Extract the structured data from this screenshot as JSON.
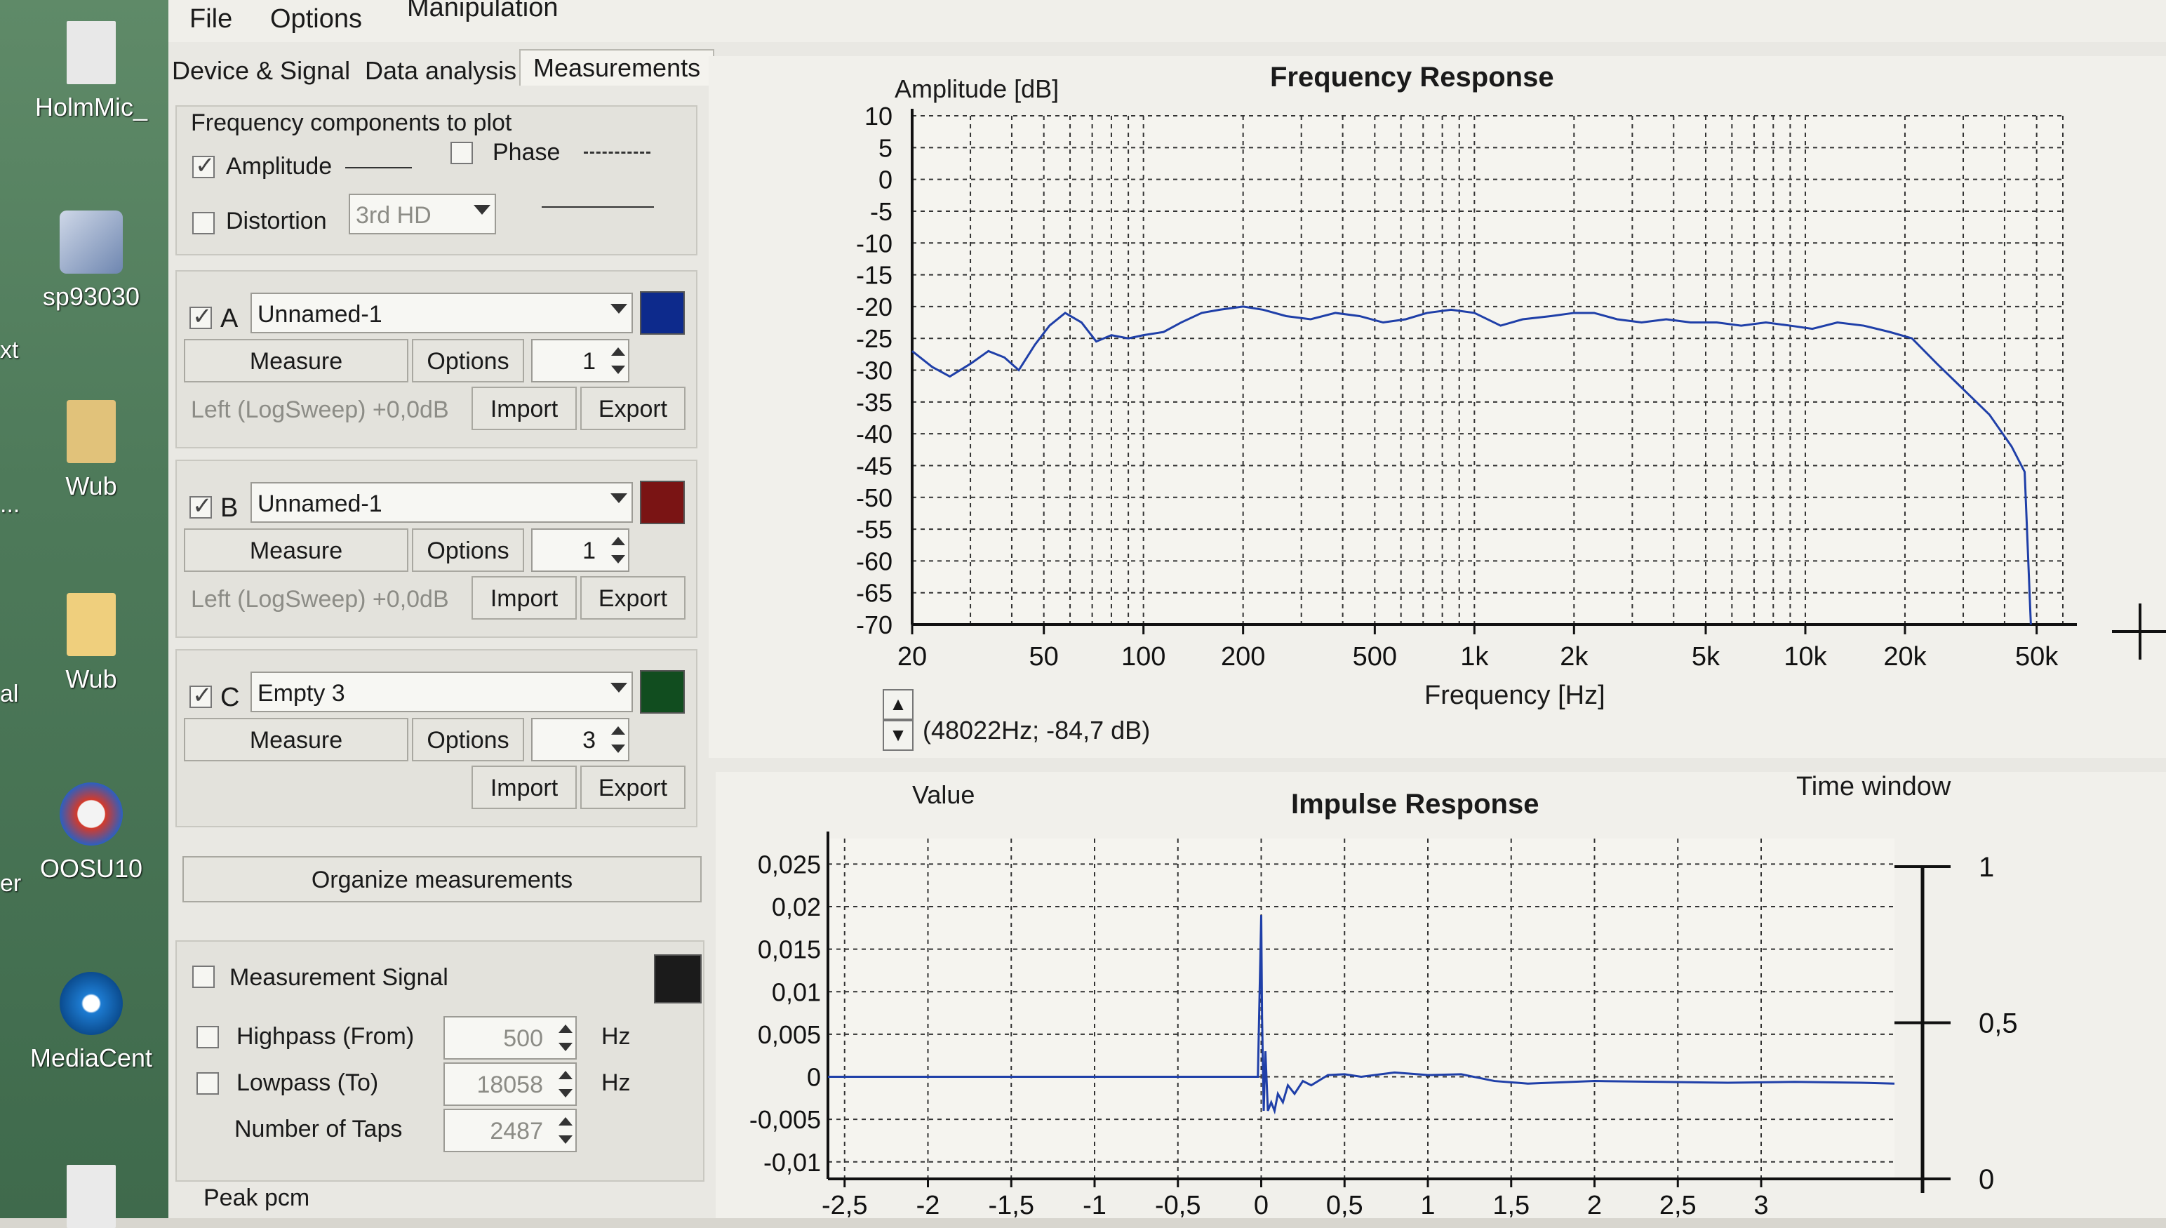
{
  "desktop": {
    "icons": [
      {
        "label": "HolmMic_",
        "icon": "document-icon"
      },
      {
        "label": "sp93030",
        "icon": "installer-icon"
      },
      {
        "label": "Wub",
        "icon": "archive-icon"
      },
      {
        "label": "Wub",
        "icon": "folder-icon"
      },
      {
        "label": "OOSU10",
        "icon": "shield-app-icon"
      },
      {
        "label": "MediaCent",
        "icon": "media-icon"
      }
    ],
    "edge_labels": [
      "xt",
      "...",
      "al",
      "er"
    ]
  },
  "menu": {
    "file": "File",
    "options": "Options",
    "manipulation": "Manipulation"
  },
  "tabs": [
    "Device & Signal",
    "Data analysis",
    "Measurements"
  ],
  "plot_components": {
    "group_label": "Frequency components to plot",
    "amplitude": {
      "label": "Amplitude",
      "checked": true
    },
    "phase": {
      "label": "Phase",
      "checked": false
    },
    "distortion": {
      "label": "Distortion",
      "checked": false,
      "value": "3rd HD"
    }
  },
  "measurements": [
    {
      "letter": "A",
      "checked": true,
      "name": "Unnamed-1",
      "color": "#0d2a8c",
      "measure": "Measure",
      "options": "Options",
      "count": "1",
      "info": "Left (LogSweep) +0,0dB",
      "import": "Import",
      "export": "Export"
    },
    {
      "letter": "B",
      "checked": true,
      "name": "Unnamed-1",
      "color": "#7a1414",
      "measure": "Measure",
      "options": "Options",
      "count": "1",
      "info": "Left (LogSweep) +0,0dB",
      "import": "Import",
      "export": "Export"
    },
    {
      "letter": "C",
      "checked": true,
      "name": "Empty 3",
      "color": "#114d1f",
      "measure": "Measure",
      "options": "Options",
      "count": "3",
      "info": "",
      "import": "Import",
      "export": "Export"
    }
  ],
  "organize_label": "Organize measurements",
  "signal": {
    "label": "Measurement Signal",
    "color": "#1b1b1b",
    "highpass": {
      "label": "Highpass (From)",
      "value": "500",
      "unit": "Hz"
    },
    "lowpass": {
      "label": "Lowpass (To)",
      "value": "18058",
      "unit": "Hz"
    },
    "taps": {
      "label": "Number of Taps",
      "value": "2487"
    },
    "peak_label": "Peak pcm"
  },
  "cursor_readout": "(48022Hz; -84,7 dB)",
  "chart_data": [
    {
      "type": "line",
      "title": "Frequency Response",
      "ylabel": "Amplitude [dB]",
      "xlabel": "Frequency [Hz]",
      "x_scale": "log",
      "xlim": [
        20,
        60000
      ],
      "ylim": [
        -70,
        10
      ],
      "grid": true,
      "x_ticks": [
        20,
        50,
        100,
        200,
        500,
        1000,
        2000,
        5000,
        10000,
        20000,
        50000
      ],
      "x_tick_labels": [
        "20",
        "50",
        "100",
        "200",
        "500",
        "1k",
        "2k",
        "5k",
        "10k",
        "20k",
        "50k"
      ],
      "y_ticks": [
        10,
        5,
        0,
        -5,
        -10,
        -15,
        -20,
        -25,
        -30,
        -35,
        -40,
        -45,
        -50,
        -55,
        -60,
        -65,
        -70
      ],
      "y_tick_labels": [
        "10",
        "5",
        "0",
        "-5",
        "-10",
        "-15",
        "-20",
        "-25",
        "-30",
        "-35",
        "-40",
        "-45",
        "-50",
        "-55",
        "-60",
        "-65",
        "-70"
      ],
      "series": [
        {
          "color": "#1f3fa8",
          "x": [
            20,
            23,
            26,
            30,
            34,
            38,
            42,
            47,
            52,
            58,
            65,
            72,
            80,
            90,
            100,
            115,
            130,
            150,
            170,
            200,
            230,
            270,
            320,
            380,
            450,
            530,
            620,
            720,
            850,
            1000,
            1200,
            1400,
            1700,
            2000,
            2300,
            2700,
            3200,
            3800,
            4500,
            5400,
            6400,
            7600,
            9000,
            10500,
            12500,
            15000,
            18000,
            21000,
            25000,
            30000,
            36000,
            42000,
            46000,
            48022
          ],
          "y": [
            -27,
            -29.5,
            -31,
            -29,
            -27,
            -28,
            -30,
            -26,
            -23,
            -21,
            -22.5,
            -25.5,
            -24.5,
            -25,
            -24.5,
            -24,
            -22.5,
            -21,
            -20.5,
            -20,
            -20.5,
            -21.5,
            -22,
            -21,
            -21.5,
            -22.5,
            -22,
            -21,
            -20.5,
            -21,
            -23,
            -22,
            -21.5,
            -21,
            -21,
            -22,
            -22.5,
            -22,
            -22.5,
            -22.5,
            -23,
            -22.5,
            -23,
            -23.5,
            -22.5,
            -23,
            -24,
            -25,
            -29,
            -33,
            -37,
            -42,
            -46,
            -84.7
          ]
        }
      ]
    },
    {
      "type": "line",
      "title": "Impulse Response",
      "ylabel": "Value",
      "secondary_axis_label": "Time window",
      "xlim": [
        -2.6,
        3.8
      ],
      "ylim": [
        -0.012,
        0.028
      ],
      "grid": true,
      "x_ticks": [
        -2.5,
        -2,
        -1.5,
        -1,
        -0.5,
        0,
        0.5,
        1,
        1.5,
        2,
        2.5,
        3
      ],
      "x_tick_labels": [
        "-2,5",
        "-2",
        "-1,5",
        "-1",
        "-0,5",
        "0",
        "0,5",
        "1",
        "1,5",
        "2",
        "2,5",
        "3"
      ],
      "y_ticks": [
        0.025,
        0.02,
        0.015,
        0.01,
        0.005,
        0,
        -0.005,
        -0.01
      ],
      "y_tick_labels": [
        "0,025",
        "0,02",
        "0,015",
        "0,01",
        "0,005",
        "0",
        "-0,005",
        "-0,01"
      ],
      "right_ticks": [
        1,
        0.5,
        0
      ],
      "right_tick_labels": [
        "1",
        "0,5",
        "0"
      ],
      "series": [
        {
          "color": "#1f3fa8",
          "x": [
            -2.6,
            -0.02,
            0,
            0.005,
            0.015,
            0.025,
            0.04,
            0.06,
            0.08,
            0.1,
            0.13,
            0.16,
            0.2,
            0.25,
            0.3,
            0.4,
            0.5,
            0.6,
            0.8,
            1.0,
            1.2,
            1.4,
            1.6,
            2.0,
            2.4,
            2.8,
            3.2,
            3.6,
            3.8
          ],
          "y": [
            0,
            0,
            0.019,
            0.007,
            -0.004,
            0.003,
            -0.004,
            -0.003,
            -0.004,
            -0.002,
            -0.003,
            -0.001,
            -0.002,
            -0.0005,
            -0.001,
            0.0002,
            0.0003,
            0,
            0.0005,
            0.0002,
            0.0003,
            -0.0005,
            -0.0008,
            -0.0005,
            -0.0006,
            -0.0007,
            -0.0006,
            -0.0007,
            -0.0008
          ]
        }
      ]
    }
  ]
}
